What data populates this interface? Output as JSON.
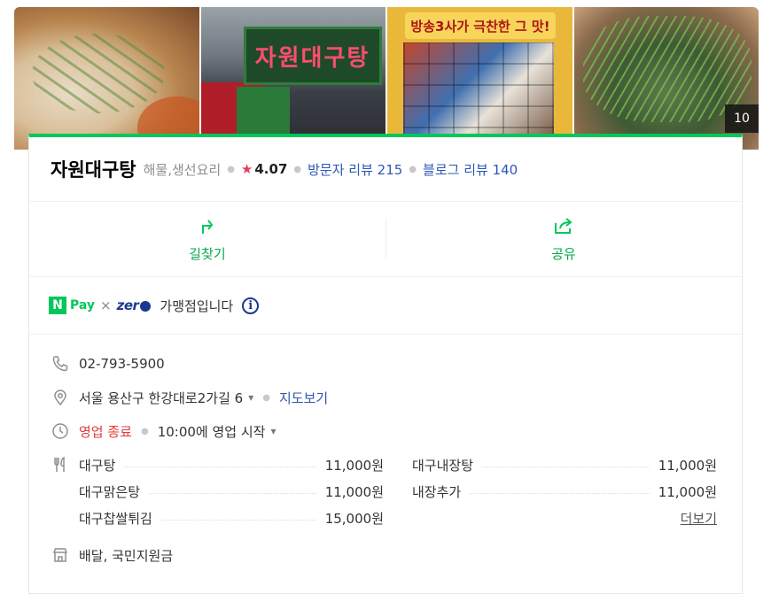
{
  "photos": {
    "count": "10",
    "items": [
      {
        "label": "daegutang-soup-photo",
        "color": "#d9bf9a"
      },
      {
        "label": "storefront-photo",
        "color": "#3a3f46",
        "sign": "자원대구탕"
      },
      {
        "label": "celebrity-collage-photo",
        "color": "#e9b83a",
        "banner": "방송3사가 극찬한 그 맛!"
      },
      {
        "label": "pot-with-greens-photo",
        "color": "#5e7a4a"
      }
    ]
  },
  "place": {
    "name": "자원대구탕",
    "category": "해물,생선요리",
    "rating": "4.07",
    "visitor_reviews": "방문자 리뷰 215",
    "blog_reviews": "블로그 리뷰 140"
  },
  "actions": {
    "directions": "길찾기",
    "share": "공유"
  },
  "pay": {
    "npay_n": "N",
    "npay_text": "Pay",
    "x": "×",
    "zero": "zer",
    "merchant_text": "가맹점입니다",
    "info_icon": "i"
  },
  "details": {
    "phone": "02-793-5900",
    "address": "서울 용산구 한강대로2가길 6",
    "map_link": "지도보기",
    "status": "영업 종료",
    "hours": "10:00에 영업 시작",
    "delivery": "배달, 국민지원금"
  },
  "menu": {
    "items": [
      {
        "name": "대구탕",
        "price": "11,000원"
      },
      {
        "name": "대구내장탕",
        "price": "11,000원"
      },
      {
        "name": "대구맑은탕",
        "price": "11,000원"
      },
      {
        "name": "내장추가",
        "price": "11,000원"
      },
      {
        "name": "대구찹쌀튀김",
        "price": "15,000원"
      }
    ],
    "more": "더보기"
  },
  "colors": {
    "brand_green": "#03c75a",
    "link_blue": "#2c57b5",
    "closed_red": "#e33a3a",
    "star_red": "#e63c54"
  }
}
